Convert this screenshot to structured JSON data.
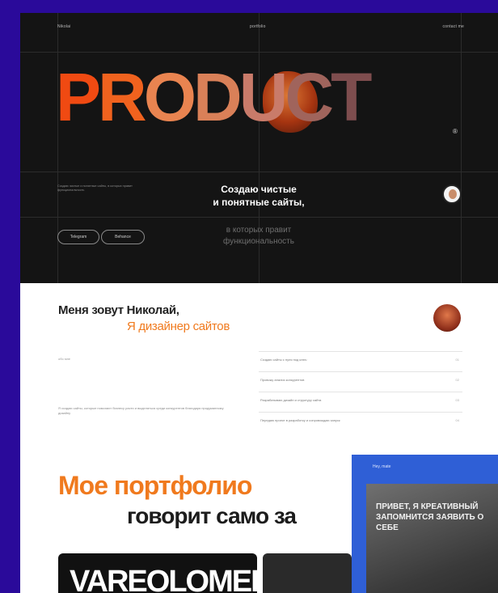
{
  "hero": {
    "nav_left": "Nikolai",
    "nav_center": "portfolio",
    "nav_right": "contact me",
    "product_letters": [
      "P",
      "R",
      "O",
      "D",
      "U",
      "C",
      "T"
    ],
    "registered": "®",
    "small_text": "Создаю чистые и понятные сайты, в которых правит функциональность",
    "headline_line1": "Создаю чистые",
    "headline_line2": "и понятные сайты,",
    "sub_line1": "в которых правит",
    "sub_line2": "функциональность",
    "pill1": "Telegram",
    "pill2": "Behance"
  },
  "about": {
    "name": "Меня зовут Николай,",
    "role": "Я дизайнер сайтов",
    "label": "обо мне",
    "description": "Я создаю сайты, которые помогают бизнесу расти и выделяться среди конкурентов благодаря продуманному дизайну",
    "list": [
      {
        "text": "Создаю сайты с нуля под ключ",
        "num": "01"
      },
      {
        "text": "Провожу анализ конкурентов",
        "num": "02"
      },
      {
        "text": "Разрабатываю дизайн и структуру сайта",
        "num": "03"
      },
      {
        "text": "Передаю проект в разработку и сопровождаю запуск",
        "num": "04"
      }
    ]
  },
  "portfolio": {
    "title": "Мое портфолио",
    "subtitle": "говорит само за",
    "card1_text": "VAREOLOMEEV"
  },
  "overlay": {
    "title": "Hey, mate",
    "text": "ПРИВЕТ, Я КРЕАТИВНЫЙ ЗАПОМНИТСЯ ЗАЯВИТЬ О СЕБЕ"
  }
}
